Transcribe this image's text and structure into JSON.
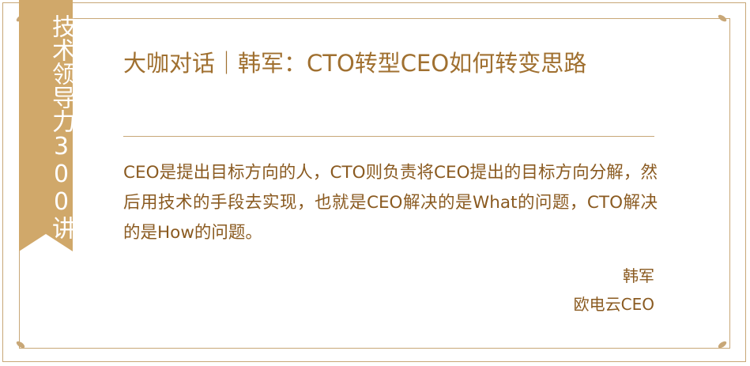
{
  "ribbon": {
    "text": "技术领导力300讲"
  },
  "title": "大咖对话｜韩军：CTO转型CEO如何转变思路",
  "quote": "CEO是提出目标方向的人，CTO则负责将CEO提出的目标方向分解，然后用技术的手段去实现，也就是CEO解决的是What的问题，CTO解决的是How的问题。",
  "author": {
    "name": "韩军",
    "title": "欧电云CEO"
  },
  "colors": {
    "accent": "#c8a777",
    "ribbon": "#d0a86a",
    "title_text": "#a07030",
    "body_text": "#8a5a20"
  }
}
